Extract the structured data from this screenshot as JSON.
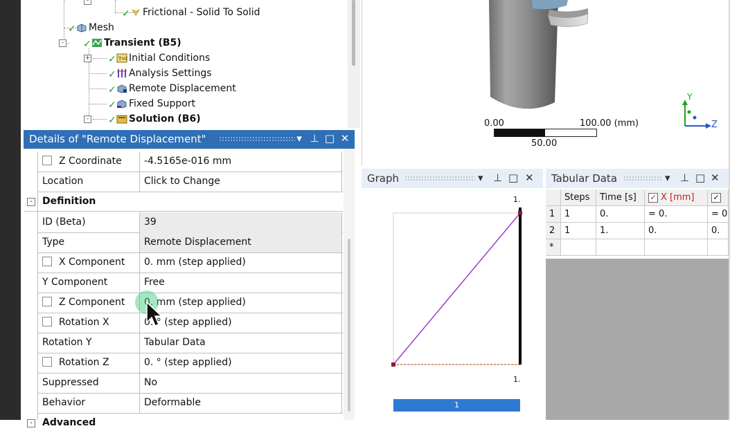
{
  "tree": {
    "items": [
      {
        "label": "Frictional - Solid To Solid"
      },
      {
        "label": "Mesh"
      },
      {
        "label": "Transient (B5)"
      },
      {
        "label": "Initial Conditions"
      },
      {
        "label": "Analysis Settings"
      },
      {
        "label": "Remote Displacement"
      },
      {
        "label": "Fixed Support"
      },
      {
        "label": "Solution (B6)"
      }
    ]
  },
  "details": {
    "title": "Details of \"Remote Displacement\"",
    "rows": [
      {
        "label": "Z Coordinate",
        "value": "-4.5165e-016 mm"
      },
      {
        "label": "Location",
        "value": "Click to Change"
      },
      {
        "section": "Definition"
      },
      {
        "label": "ID (Beta)",
        "value": "39"
      },
      {
        "label": "Type",
        "value": "Remote Displacement"
      },
      {
        "label": "X Component",
        "value": "0. mm  (step applied)"
      },
      {
        "label": "Y Component",
        "value": "Free"
      },
      {
        "label": "Z Component",
        "value": "0. mm  (step applied)"
      },
      {
        "label": "Rotation X",
        "value": "0. °  (step applied)"
      },
      {
        "label": "Rotation Y",
        "value": "Tabular Data"
      },
      {
        "label": "Rotation Z",
        "value": "0. °  (step applied)"
      },
      {
        "label": "Suppressed",
        "value": "No"
      },
      {
        "label": "Behavior",
        "value": "Deformable"
      },
      {
        "section": "Advanced"
      }
    ],
    "buttons": {
      "dropdown": "▾",
      "pin": "⊥",
      "maximize": "□",
      "close": "✕"
    }
  },
  "viewport": {
    "scale": {
      "left": "0.00",
      "right": "100.00 (mm)",
      "mid": "50.00"
    },
    "axes": {
      "y": "Y",
      "z": "Z"
    }
  },
  "graph": {
    "title": "Graph",
    "y_top": "1.",
    "x_right": "1.",
    "step_bar": "1",
    "buttons": {
      "dropdown": "▾",
      "pin": "⊥",
      "maximize": "□",
      "close": "✕"
    }
  },
  "chart_data": {
    "type": "line",
    "series": [
      {
        "x": [
          0,
          1
        ],
        "y": [
          0,
          1
        ]
      },
      {
        "x": [
          0,
          1
        ],
        "y": [
          0,
          0
        ]
      }
    ]
  },
  "tabular": {
    "title": "Tabular Data",
    "headers": [
      "Steps",
      "Time [s]",
      "X [mm]",
      ""
    ],
    "row_nums": [
      "1",
      "2",
      "*"
    ],
    "rows": [
      [
        "1",
        "0.",
        "= 0.",
        "= 0"
      ],
      [
        "1",
        "1.",
        "0.",
        "0."
      ],
      [
        "",
        "",
        "",
        ""
      ]
    ],
    "buttons": {
      "dropdown": "▾",
      "pin": "⊥",
      "maximize": "□",
      "close": "✕"
    }
  },
  "colors": {
    "header_blue": "#2f6fb5",
    "check_green": "#19a319",
    "graph_line": "#9b3cc9",
    "step_bar": "#2f7ad0"
  }
}
